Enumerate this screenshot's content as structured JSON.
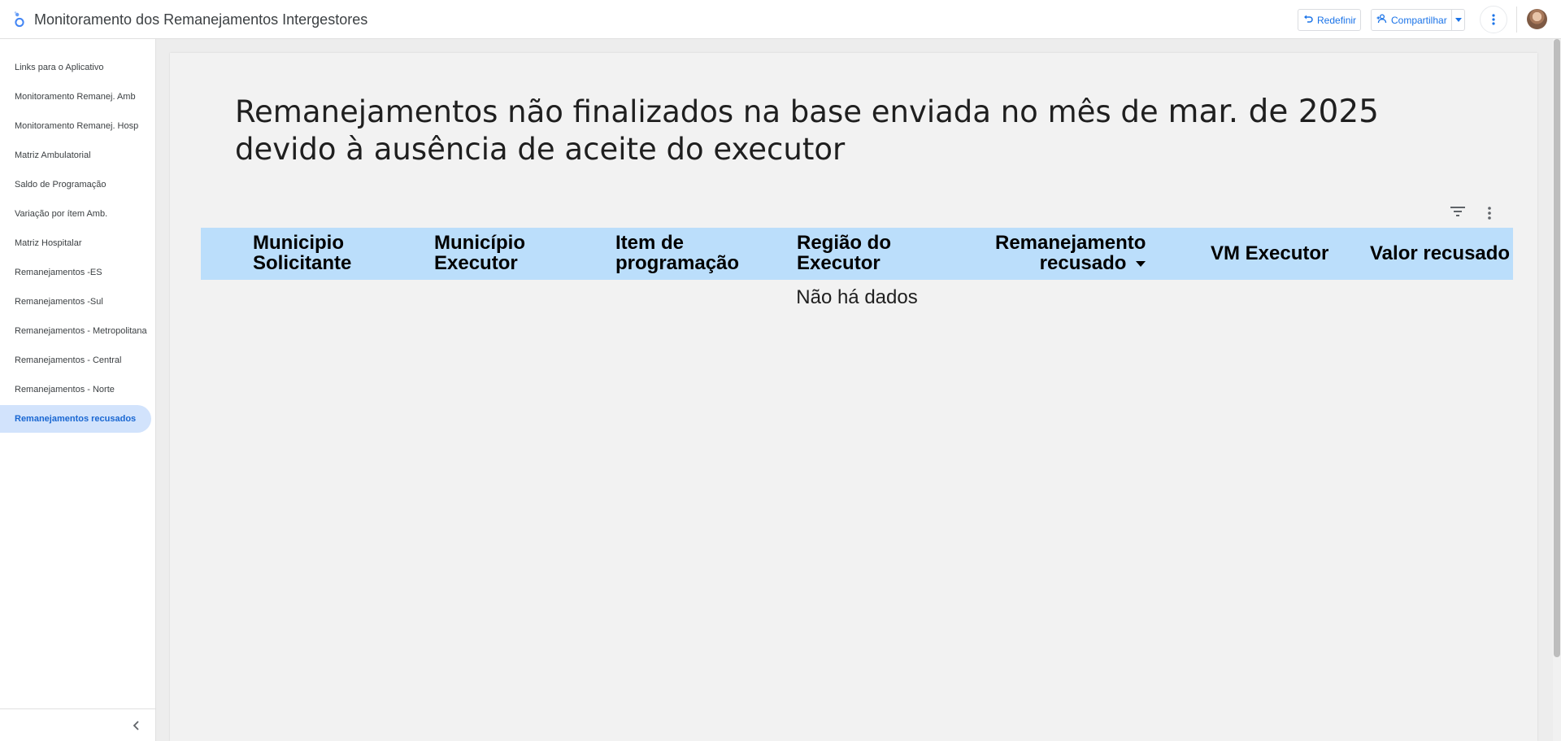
{
  "header": {
    "app_title": "Monitoramento dos Remanejamentos Intergestores",
    "reset_label": "Redefinir",
    "share_label": "Compartilhar",
    "accent_color": "#1a73e8"
  },
  "sidebar": {
    "items": [
      {
        "label": "Links para o Aplicativo"
      },
      {
        "label": "Monitoramento Remanej. Amb"
      },
      {
        "label": "Monitoramento Remanej. Hosp"
      },
      {
        "label": "Matriz Ambulatorial"
      },
      {
        "label": "Saldo de Programação"
      },
      {
        "label": "Variação por ítem Amb."
      },
      {
        "label": "Matriz Hospitalar"
      },
      {
        "label": "Remanejamentos -ES"
      },
      {
        "label": "Remanejamentos -Sul"
      },
      {
        "label": "Remanejamentos - Metropolitana"
      },
      {
        "label": "Remanejamentos - Central"
      },
      {
        "label": "Remanejamentos - Norte"
      },
      {
        "label": "Remanejamentos recusados",
        "active": true
      }
    ],
    "active_color": "#d2e3fc"
  },
  "report": {
    "title_part1": "Remanejamentos não finalizados na base enviada no mês de",
    "title_date": "mar. de 2025",
    "title_part2": "devido à ausência de aceite do executor"
  },
  "table": {
    "header_color": "#bbdefb",
    "columns": [
      {
        "line1": "Municipio",
        "line2": "Solicitante"
      },
      {
        "line1": "Município",
        "line2": "Executor"
      },
      {
        "line1": "Item de",
        "line2": "programação"
      },
      {
        "line1": "Região do",
        "line2": "Executor"
      },
      {
        "line1": "Remanejamento",
        "line2": "recusado"
      },
      {
        "line1": "VM Executor",
        "line2": ""
      },
      {
        "line1": "Valor recusado",
        "line2": ""
      }
    ],
    "empty_message": "Não há dados"
  }
}
